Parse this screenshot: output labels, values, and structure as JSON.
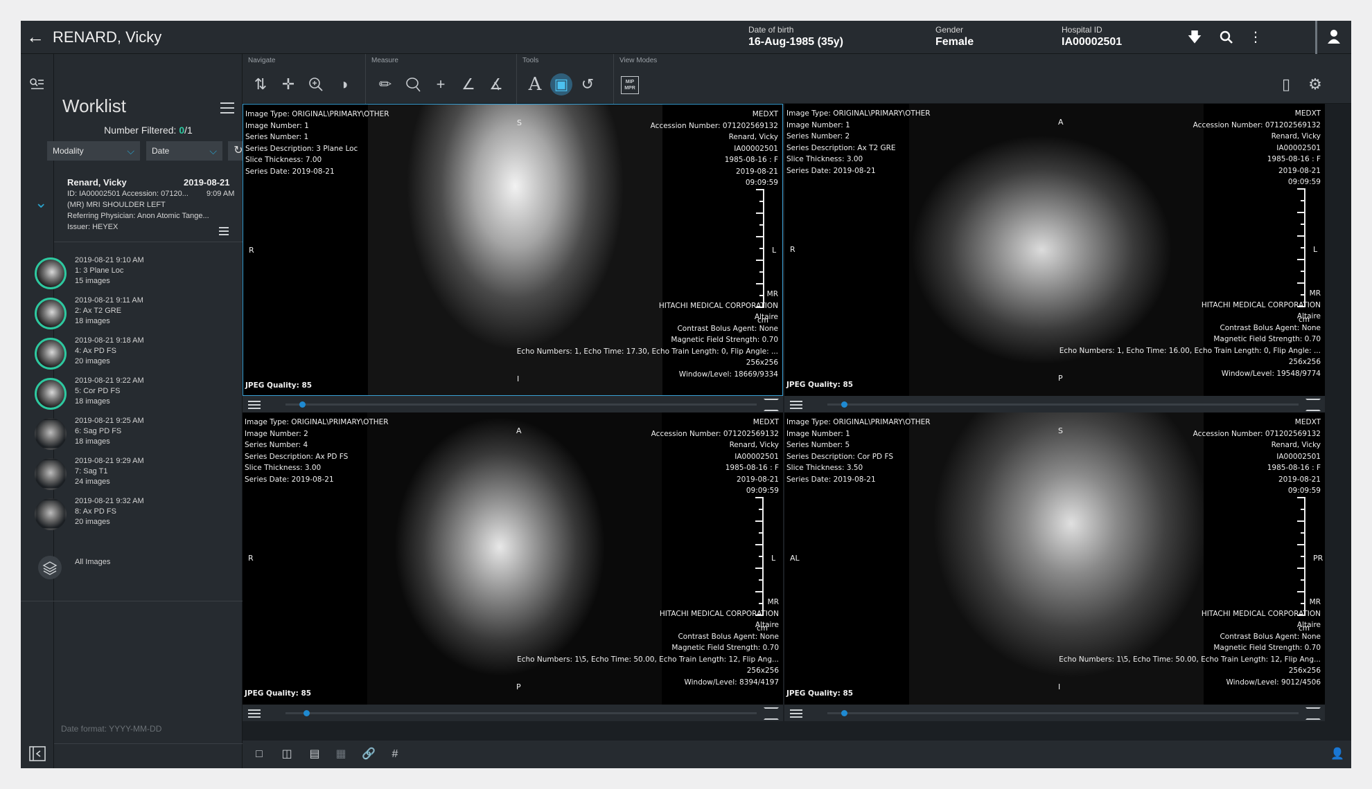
{
  "header": {
    "back_icon": "arrow-left-icon",
    "patient_name": "RENARD, Vicky",
    "dob_label": "Date of birth",
    "dob_value": "16-Aug-1985 (35y)",
    "gender_label": "Gender",
    "gender_value": "Female",
    "hospital_id_label": "Hospital ID",
    "hospital_id_value": "IA00002501",
    "icons": [
      "download-icon",
      "search-icon",
      "more-vertical-icon",
      "user-icon"
    ]
  },
  "toolbar": {
    "groups": [
      "Navigate",
      "Measure",
      "Tools",
      "View Modes"
    ],
    "mpr_label": "MIP MPR"
  },
  "worklist": {
    "title": "Worklist",
    "filtered_label": "Number Filtered:",
    "filtered_count": "0",
    "filtered_total": "/1",
    "modality_label": "Modality",
    "date_label": "Date",
    "study": {
      "name": "Renard, Vicky",
      "date": "2019-08-21",
      "id_line": "ID: IA00002501   Accession: 07120...",
      "time": "9:09 AM",
      "description": "(MR) MRI SHOULDER LEFT",
      "physician": "Referring Physician: Anon Atomic Tange...",
      "issuer": "Issuer: HEYEX"
    },
    "series": [
      {
        "datetime": "2019-08-21 9:10 AM",
        "name": "1: 3 Plane Loc",
        "count": "15 images"
      },
      {
        "datetime": "2019-08-21 9:11 AM",
        "name": "2: Ax T2 GRE",
        "count": "18 images"
      },
      {
        "datetime": "2019-08-21 9:18 AM",
        "name": "4: Ax PD FS",
        "count": "20 images"
      },
      {
        "datetime": "2019-08-21 9:22 AM",
        "name": "5: Cor PD FS",
        "count": "18 images"
      },
      {
        "datetime": "2019-08-21 9:25 AM",
        "name": "6: Sag PD FS",
        "count": "18 images"
      },
      {
        "datetime": "2019-08-21 9:29 AM",
        "name": "7: Sag T1",
        "count": "24 images"
      },
      {
        "datetime": "2019-08-21 9:32 AM",
        "name": "8: Ax PD FS",
        "count": "20 images"
      }
    ],
    "all_images": "All Images",
    "date_format": "Date format: YYYY-MM-DD"
  },
  "viewports": [
    {
      "tl": [
        "Image Type: ORIGINAL\\PRIMARY\\OTHER",
        "Image Number: 1",
        "Series Number: 1",
        "Series Description: 3 Plane Loc",
        "Slice Thickness: 7.00",
        "Series Date: 2019-08-21"
      ],
      "tr": [
        "MEDXT",
        "Accession Number: 071202569132",
        "Renard, Vicky",
        "IA00002501",
        "1985-08-16 : F",
        "2019-08-21",
        "09:09:59"
      ],
      "br": [
        "MR",
        "HITACHI MEDICAL CORPORATION",
        "Altaire",
        "Contrast Bolus Agent: None",
        "Magnetic Field Strength: 0.70",
        "Echo Numbers: 1, Echo Time: 17.30, Echo Train Length: 0, Flip Angle: ...",
        "256x256",
        "Window/Level: 18669/9334"
      ],
      "unit": "cm",
      "jpeg": "JPEG Quality: 85",
      "orient": {
        "top": "S",
        "left": "R",
        "right": "L",
        "bottom": "I"
      }
    },
    {
      "tl": [
        "Image Type: ORIGINAL\\PRIMARY\\OTHER",
        "Image Number: 1",
        "Series Number: 2",
        "Series Description: Ax T2 GRE",
        "Slice Thickness: 3.00",
        "Series Date: 2019-08-21"
      ],
      "tr": [
        "MEDXT",
        "Accession Number: 071202569132",
        "Renard, Vicky",
        "IA00002501",
        "1985-08-16 : F",
        "2019-08-21",
        "09:09:59"
      ],
      "br": [
        "MR",
        "HITACHI MEDICAL CORPORATION",
        "Altaire",
        "Contrast Bolus Agent: None",
        "Magnetic Field Strength: 0.70",
        "Echo Numbers: 1, Echo Time: 16.00, Echo Train Length: 0, Flip Angle: ...",
        "256x256",
        "Window/Level: 19548/9774"
      ],
      "unit": "cm",
      "jpeg": "JPEG Quality: 85",
      "orient": {
        "top": "A",
        "left": "R",
        "right": "L",
        "bottom": "P"
      }
    },
    {
      "tl": [
        "Image Type: ORIGINAL\\PRIMARY\\OTHER",
        "Image Number: 2",
        "Series Number: 4",
        "Series Description: Ax PD FS",
        "Slice Thickness: 3.00",
        "Series Date: 2019-08-21"
      ],
      "tr": [
        "MEDXT",
        "Accession Number: 071202569132",
        "Renard, Vicky",
        "IA00002501",
        "1985-08-16 : F",
        "2019-08-21",
        "09:09:59"
      ],
      "br": [
        "MR",
        "HITACHI MEDICAL CORPORATION",
        "Altaire",
        "Contrast Bolus Agent: None",
        "Magnetic Field Strength: 0.70",
        "Echo Numbers: 1\\5, Echo Time: 50.00, Echo Train Length: 12, Flip Ang...",
        "256x256",
        "Window/Level: 8394/4197"
      ],
      "unit": "cm",
      "jpeg": "JPEG Quality: 85",
      "orient": {
        "top": "A",
        "left": "R",
        "right": "L",
        "bottom": "P"
      }
    },
    {
      "tl": [
        "Image Type: ORIGINAL\\PRIMARY\\OTHER",
        "Image Number: 1",
        "Series Number: 5",
        "Series Description: Cor PD FS",
        "Slice Thickness: 3.50",
        "Series Date: 2019-08-21"
      ],
      "tr": [
        "MEDXT",
        "Accession Number: 071202569132",
        "Renard, Vicky",
        "IA00002501",
        "1985-08-16 : F",
        "2019-08-21",
        "09:09:59"
      ],
      "br": [
        "MR",
        "HITACHI MEDICAL CORPORATION",
        "Altaire",
        "Contrast Bolus Agent: None",
        "Magnetic Field Strength: 0.70",
        "Echo Numbers: 1\\5, Echo Time: 50.00, Echo Train Length: 12, Flip Ang...",
        "256x256",
        "Window/Level: 9012/4506"
      ],
      "unit": "cm",
      "jpeg": "JPEG Quality: 85",
      "orient": {
        "top": "S",
        "left": "AL",
        "right": "PR",
        "bottom": "I"
      }
    }
  ]
}
